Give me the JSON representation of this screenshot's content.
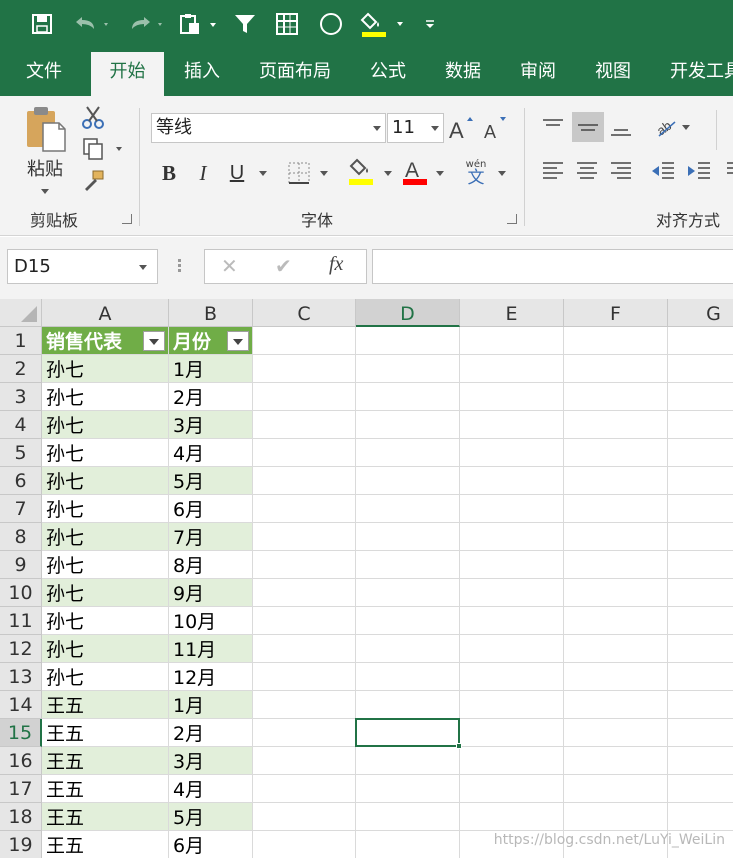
{
  "ribbon_tabs": [
    "文件",
    "开始",
    "插入",
    "页面布局",
    "公式",
    "数据",
    "审阅",
    "视图",
    "开发工具"
  ],
  "active_tab": "开始",
  "clipboard": {
    "paste_label": "粘贴",
    "group_label": "剪贴板"
  },
  "font": {
    "name": "等线",
    "size": "11",
    "group_label": "字体",
    "bold": "B",
    "italic": "I",
    "underline": "U",
    "phonetic_top": "wén",
    "phonetic_bottom": "文"
  },
  "alignment": {
    "group_label": "对齐方式"
  },
  "formula_bar": {
    "name_box": "D15",
    "cancel": "✕",
    "enter": "✔",
    "fx": "fx",
    "formula": ""
  },
  "columns": [
    "A",
    "B",
    "C",
    "D",
    "E",
    "F",
    "G"
  ],
  "selected_column": "D",
  "selected_row": "15",
  "rows": [
    "1",
    "2",
    "3",
    "4",
    "5",
    "6",
    "7",
    "8",
    "9",
    "10",
    "11",
    "12",
    "13",
    "14",
    "15",
    "16",
    "17",
    "18",
    "19"
  ],
  "table": {
    "headers": [
      "销售代表",
      "月份"
    ],
    "data": [
      [
        "孙七",
        "1月"
      ],
      [
        "孙七",
        "2月"
      ],
      [
        "孙七",
        "3月"
      ],
      [
        "孙七",
        "4月"
      ],
      [
        "孙七",
        "5月"
      ],
      [
        "孙七",
        "6月"
      ],
      [
        "孙七",
        "7月"
      ],
      [
        "孙七",
        "8月"
      ],
      [
        "孙七",
        "9月"
      ],
      [
        "孙七",
        "10月"
      ],
      [
        "孙七",
        "11月"
      ],
      [
        "孙七",
        "12月"
      ],
      [
        "王五",
        "1月"
      ],
      [
        "王五",
        "2月"
      ],
      [
        "王五",
        "3月"
      ],
      [
        "王五",
        "4月"
      ],
      [
        "王五",
        "5月"
      ],
      [
        "王五",
        "6月"
      ]
    ]
  },
  "colors": {
    "excel_green": "#217346",
    "table_header": "#70ad47",
    "band": "#e2efda",
    "highlight_yellow": "#ffff00",
    "font_red": "#ff0000"
  },
  "watermark": "https://blog.csdn.net/LuYi_WeiLin"
}
